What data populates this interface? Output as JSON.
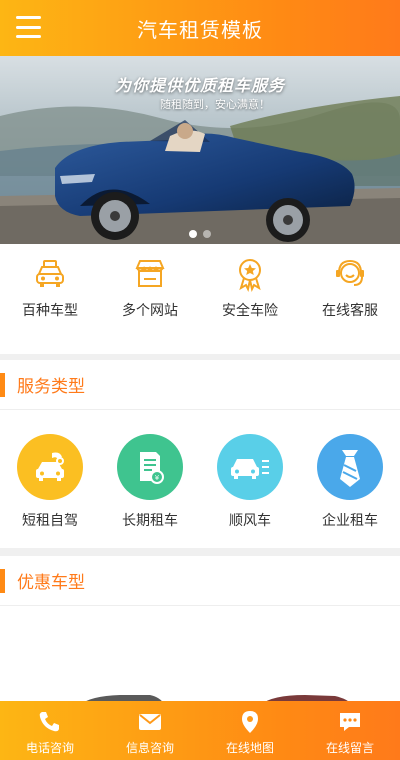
{
  "header": {
    "title": "汽车租赁模板"
  },
  "banner": {
    "headline": "为你提供优质租车服务",
    "subtitle": "随租随到，安心满意！",
    "slides": 2,
    "active_slide": 1
  },
  "features": [
    {
      "label": "百种车型",
      "icon": "taxi-icon"
    },
    {
      "label": "多个网站",
      "icon": "store-icon"
    },
    {
      "label": "安全车险",
      "icon": "badge-icon"
    },
    {
      "label": "在线客服",
      "icon": "headset-icon"
    }
  ],
  "services_section": {
    "title": "服务类型"
  },
  "services": [
    {
      "label": "短租自驾",
      "icon": "car-map-icon",
      "color": "#fbbf22"
    },
    {
      "label": "长期租车",
      "icon": "contract-icon",
      "color": "#3fc48f"
    },
    {
      "label": "顺风车",
      "icon": "car-lines-icon",
      "color": "#59cfe8"
    },
    {
      "label": "企业租车",
      "icon": "tie-icon",
      "color": "#4aa8ea"
    }
  ],
  "deals_section": {
    "title": "优惠车型"
  },
  "bottom_nav": [
    {
      "label": "电话咨询",
      "icon": "phone-icon"
    },
    {
      "label": "信息咨询",
      "icon": "mail-icon"
    },
    {
      "label": "在线地图",
      "icon": "location-icon"
    },
    {
      "label": "在线留言",
      "icon": "message-icon"
    }
  ],
  "colors": {
    "accent": "#ff8a14",
    "accent_light": "#fdb614",
    "section_title": "#ff7a1a"
  }
}
